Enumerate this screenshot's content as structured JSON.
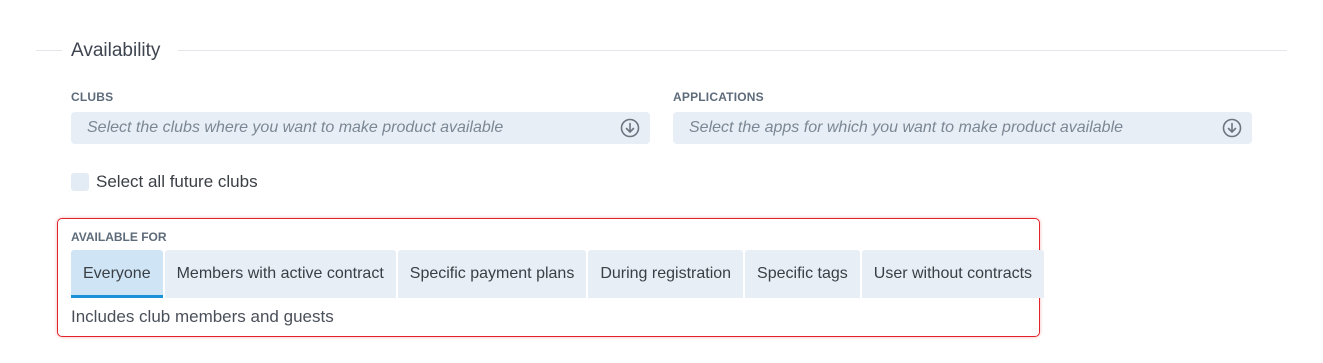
{
  "section": {
    "title": "Availability"
  },
  "clubs": {
    "label": "CLUBS",
    "placeholder": "Select the clubs where you want to make product available",
    "icon": "arrow-down-circle-icon"
  },
  "applications": {
    "label": "APPLICATIONS",
    "placeholder": "Select the apps for which you want to make product available",
    "icon": "arrow-down-circle-icon"
  },
  "future_clubs": {
    "label": "Select all future clubs",
    "checked": false
  },
  "available_for": {
    "label": "AVAILABLE FOR",
    "tabs": [
      {
        "label": "Everyone",
        "active": true
      },
      {
        "label": "Members with active contract",
        "active": false
      },
      {
        "label": "Specific payment plans",
        "active": false
      },
      {
        "label": "During registration",
        "active": false
      },
      {
        "label": "Specific tags",
        "active": false
      },
      {
        "label": "User without contracts",
        "active": false
      }
    ],
    "description": "Includes club members and guests"
  },
  "colors": {
    "accent": "#1a90d8",
    "highlight_border": "#e0242a",
    "input_bg": "#e8eef5",
    "active_tab_bg": "#cfe5f5"
  }
}
